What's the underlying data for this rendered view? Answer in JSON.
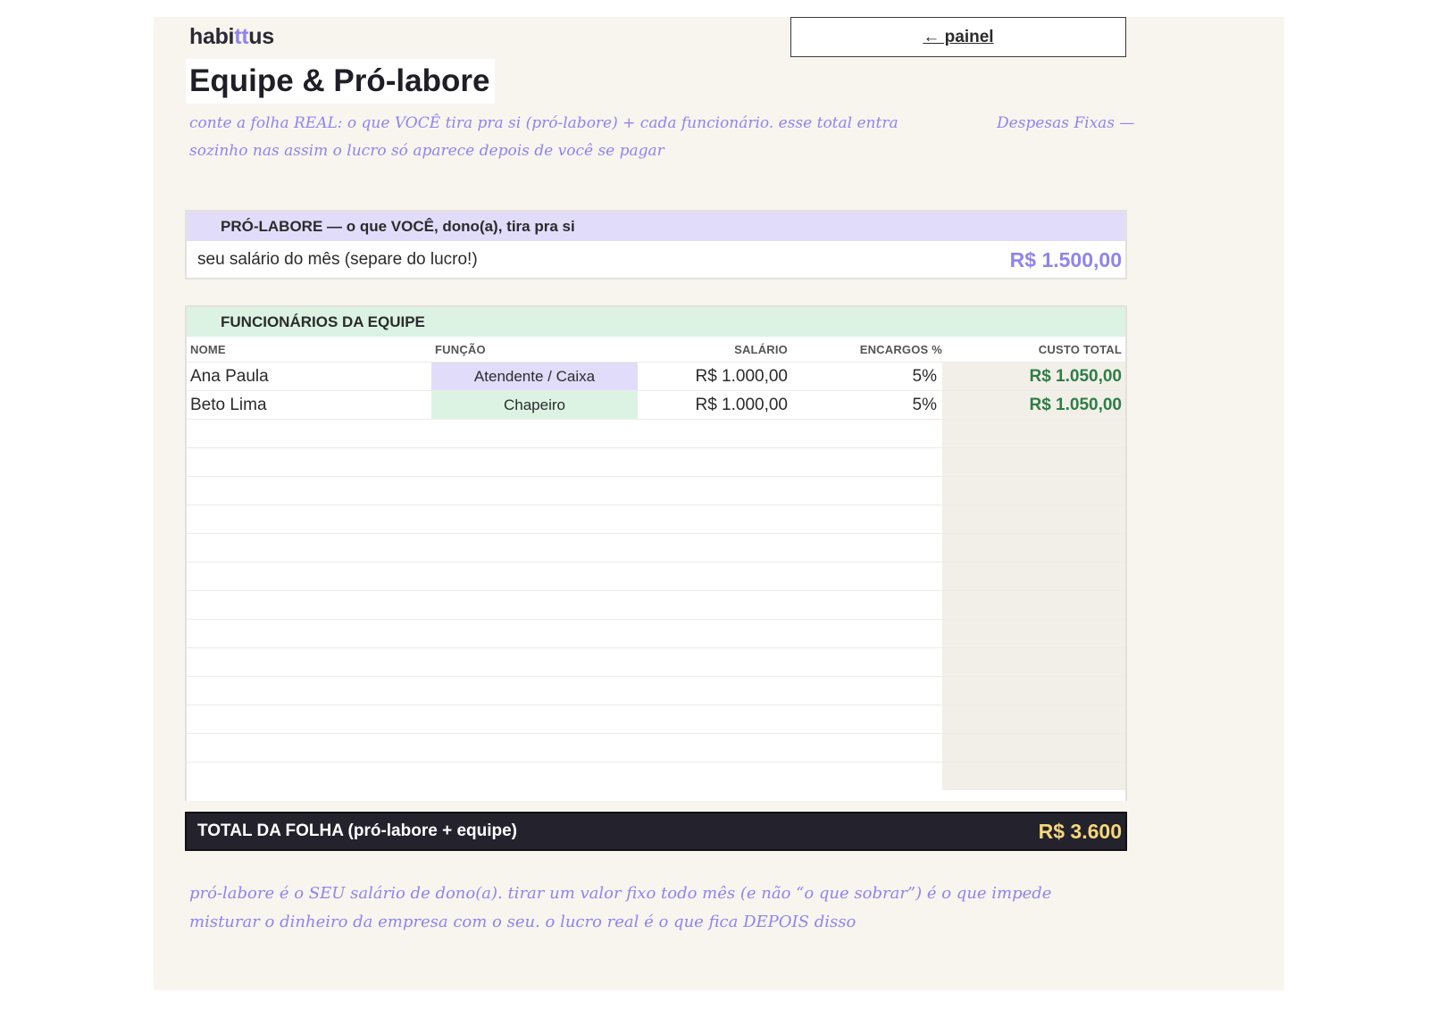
{
  "brand": {
    "pre": "habi",
    "accent": "tt",
    "post": "us"
  },
  "nav": {
    "back_label": "← painel"
  },
  "page": {
    "title": "Equipe & Pró-labore",
    "intro": "conte a folha REAL: o que VOCÊ tira pra si (pró-labore) + cada funcionário. esse total entra sozinho nas assim o lucro só aparece depois de você se pagar",
    "intro_aside": "Despesas Fixas —"
  },
  "pro_labore": {
    "heading": "PRÓ-LABORE — o que VOCÊ, dono(a), tira pra si",
    "label": "seu salário do mês (separe do lucro!)",
    "value": "R$ 1.500,00"
  },
  "team": {
    "heading": "FUNCIONÁRIOS DA EQUIPE",
    "columns": [
      "NOME",
      "FUNÇÃO",
      "SALÁRIO",
      "ENCARGOS %",
      "CUSTO TOTAL"
    ],
    "rows": [
      {
        "name": "Ana Paula",
        "role": "Atendente / Caixa",
        "salary": "R$ 1.000,00",
        "charges": "5%",
        "total": "R$ 1.050,00"
      },
      {
        "name": "Beto Lima",
        "role": "Chapeiro",
        "salary": "R$ 1.000,00",
        "charges": "5%",
        "total": "R$ 1.050,00"
      }
    ]
  },
  "summary": {
    "label": "TOTAL DA FOLHA (pró-labore + equipe)",
    "value": "R$ 3.600"
  },
  "footer": {
    "note": "pró-labore é o SEU salário de dono(a). tirar um valor fixo todo mês (e não “o que sobrar”) é o que impede misturar o dinheiro da empresa com o seu. o lucro real é o que fica DEPOIS disso"
  },
  "colors": {
    "accent": "#8f84ee",
    "lilac": "#e2dcfb",
    "mint": "#dcf3e4",
    "green_value": "#2e7d47",
    "total_bar": "#24222c",
    "total_value": "#f5d77c"
  }
}
